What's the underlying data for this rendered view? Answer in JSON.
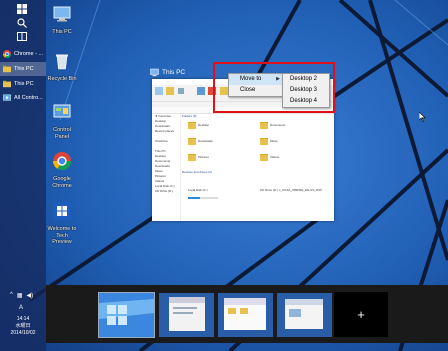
{
  "taskbar": {
    "items": [
      {
        "label": "Chrome - ..."
      },
      {
        "label": "This PC"
      },
      {
        "label": "This PC"
      },
      {
        "label": "All Contro..."
      }
    ],
    "tray": {
      "ime": "A",
      "time": "14:14",
      "weekday": "水曜日",
      "date": "2014/10/02"
    }
  },
  "desktop": {
    "icons": [
      {
        "label": "This PC"
      },
      {
        "label": "Recycle Bin"
      },
      {
        "label": "Control Panel"
      },
      {
        "label": "Google Chrome"
      },
      {
        "label": "Welcome to Tech Preview"
      }
    ]
  },
  "window": {
    "title": "This PC",
    "nav": [
      "★ Favorites",
      "Desktop",
      "Downloads",
      "Recent places",
      "",
      "OneDrive",
      "",
      "This PC",
      "Desktop",
      "Documents",
      "Downloads",
      "Music",
      "Pictures",
      "Videos",
      "Local Disk (C:)",
      "CD Drive (D:)"
    ],
    "sections": {
      "folders": "Folders (6)",
      "devices": "Devices and drives (2)"
    },
    "folders": [
      "Desktop",
      "Documents",
      "Downloads",
      "Music",
      "Pictures",
      "Videos"
    ],
    "drives": [
      "Local Disk (C:)",
      "CD Drive (D:) J_CCSA_X86FRE_EN-US_DV5"
    ],
    "drive_usage_fraction": 0.4
  },
  "context_menu": {
    "items": [
      {
        "label": "Move to"
      },
      {
        "label": "Close"
      }
    ],
    "submenu": [
      {
        "label": "Desktop 2"
      },
      {
        "label": "Desktop 3"
      },
      {
        "label": "Desktop 4"
      }
    ]
  },
  "desktops_strip": {
    "count": 4,
    "add_label": "+"
  },
  "colors": {
    "highlight": "#e0101a",
    "taskbar": "#16285c",
    "wallpaper": "#1a4f9e"
  }
}
